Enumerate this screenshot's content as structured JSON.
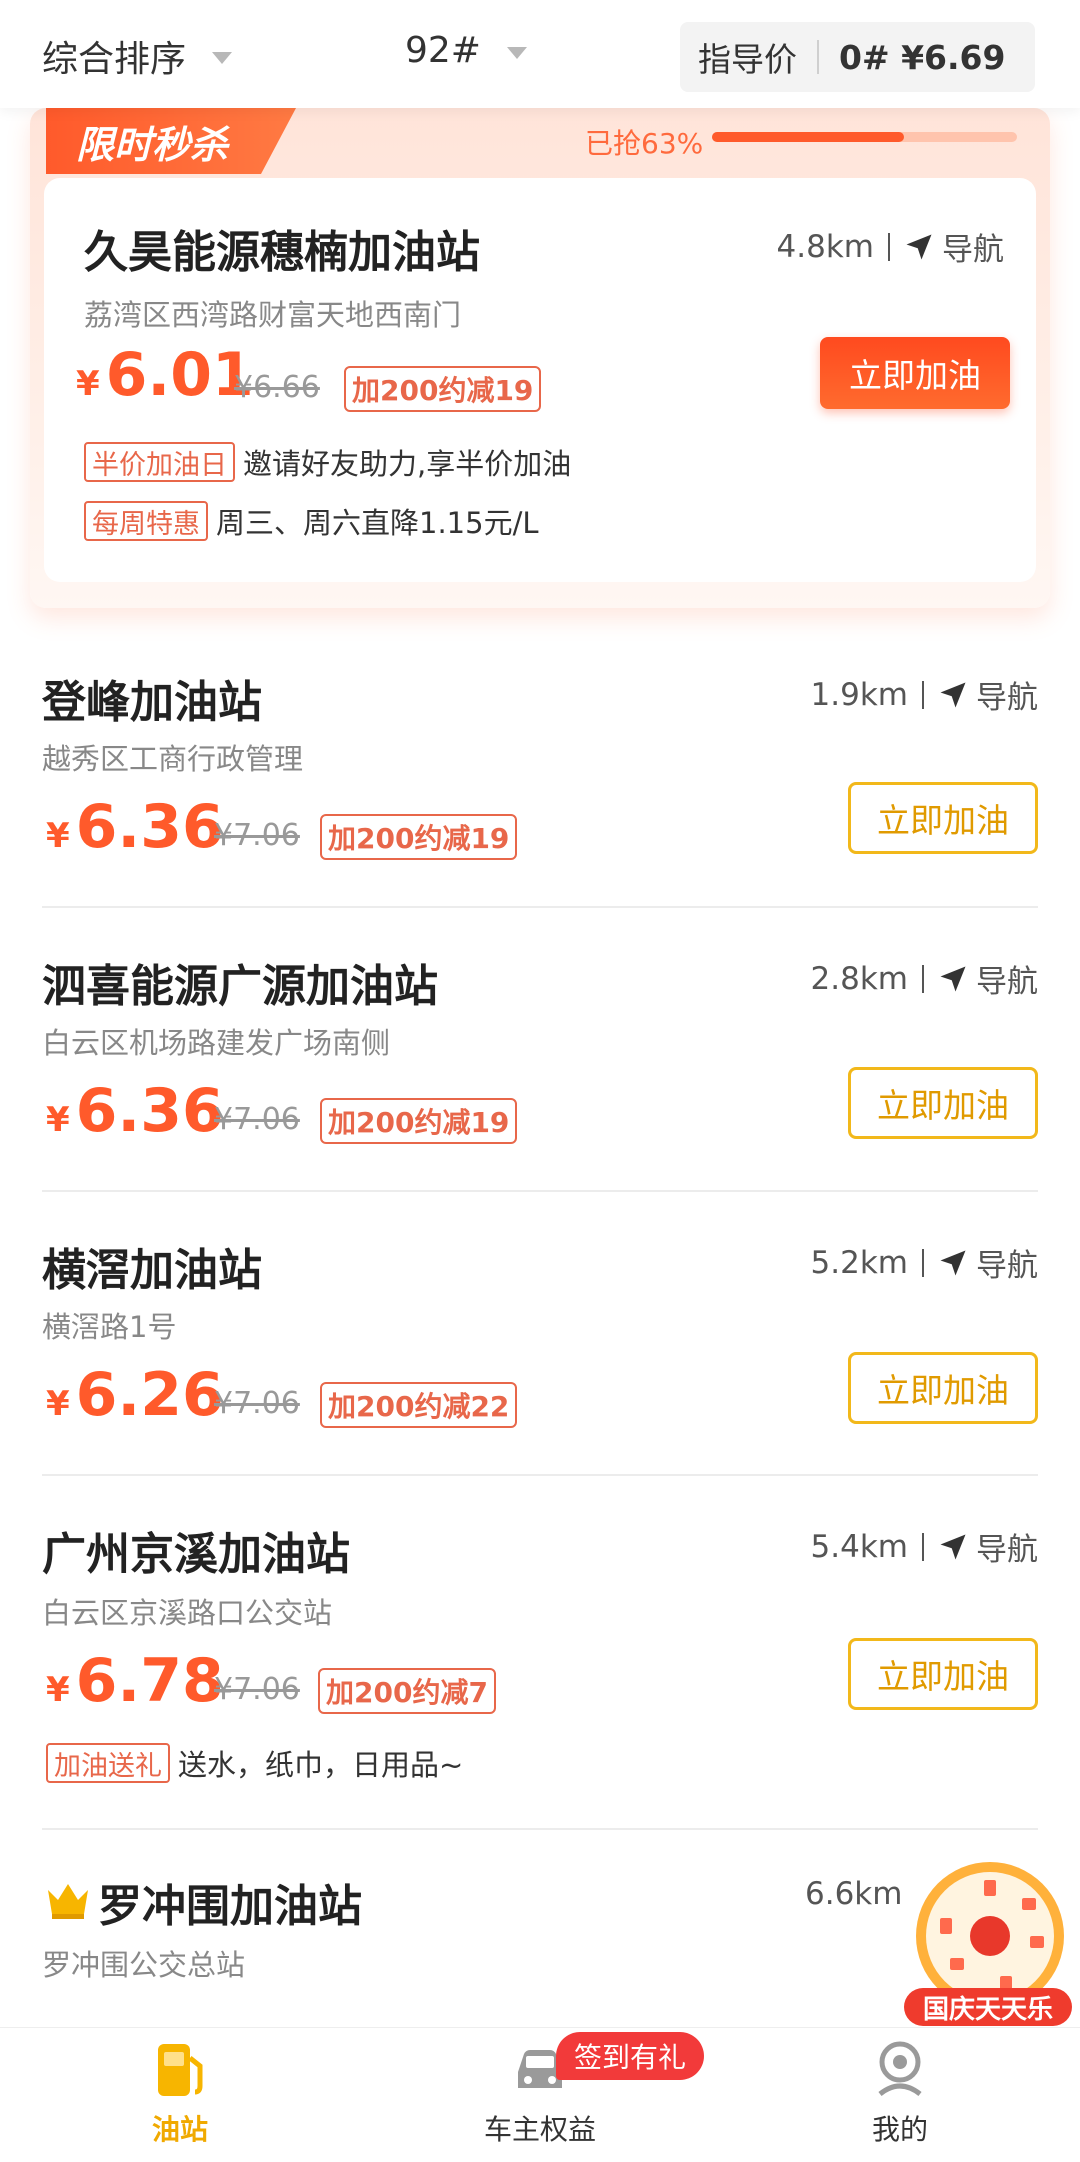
{
  "filter": {
    "sort": "综合排序",
    "fuel": "92#",
    "guide_label": "指导价",
    "guide_value": "0# ¥6.69"
  },
  "flash_sale": {
    "tag": "限时秒杀",
    "grabbed": "已抢63%",
    "progress": 0.63,
    "station": {
      "name": "久昊能源穗楠加油站",
      "address": "荔湾区西湾路财富天地西南门",
      "distance": "4.8km",
      "nav": "导航",
      "yen": "¥",
      "price": "6.01",
      "original": "¥6.66",
      "discount": "加200约减19",
      "button": "立即加油",
      "promos": [
        {
          "tag": "半价加油日",
          "text": "邀请好友助力,享半价加油"
        },
        {
          "tag": "每周特惠",
          "text": "周三、周六直降1.15元/L"
        }
      ]
    }
  },
  "stations": [
    {
      "name": "登峰加油站",
      "address": "越秀区工商行政管理",
      "distance": "1.9km",
      "nav": "导航",
      "yen": "¥",
      "price": "6.36",
      "original": "¥7.06",
      "discount": "加200约减19",
      "button": "立即加油"
    },
    {
      "name": "泗喜能源广源加油站",
      "address": "白云区机场路建发广场南侧",
      "distance": "2.8km",
      "nav": "导航",
      "yen": "¥",
      "price": "6.36",
      "original": "¥7.06",
      "discount": "加200约减19",
      "button": "立即加油"
    },
    {
      "name": "横滘加油站",
      "address": "横滘路1号",
      "distance": "5.2km",
      "nav": "导航",
      "yen": "¥",
      "price": "6.26",
      "original": "¥7.06",
      "discount": "加200约减22",
      "button": "立即加油"
    },
    {
      "name": "广州京溪加油站",
      "address": "白云区京溪路口公交站",
      "distance": "5.4km",
      "nav": "导航",
      "yen": "¥",
      "price": "6.78",
      "original": "¥7.06",
      "discount": "加200约减7",
      "button": "立即加油",
      "promo_tag": "加油送礼",
      "promo_text": "送水，纸巾，日用品~"
    },
    {
      "name": "罗冲围加油站",
      "address": "罗冲围公交总站",
      "distance": "6.6km"
    }
  ],
  "float_badge": {
    "label": "国庆天天乐"
  },
  "tabbar": {
    "items": [
      {
        "label": "油站",
        "active": true
      },
      {
        "label": "车主权益",
        "active": false
      },
      {
        "label": "我的",
        "active": false
      }
    ],
    "sign_badge": "签到有礼"
  },
  "colors": {
    "accent": "#ff5a2b",
    "button_border": "#f2b81a",
    "tab_active": "#f0a900"
  }
}
